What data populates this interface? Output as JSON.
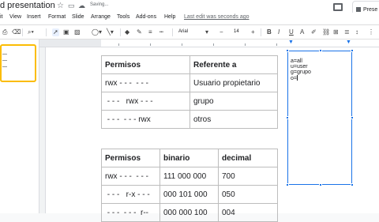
{
  "title": {
    "doc_name": "d presentation",
    "status": "Saving..."
  },
  "present_button": "Prese",
  "menu": [
    "it",
    "View",
    "Insert",
    "Format",
    "Slide",
    "Arrange",
    "Tools",
    "Add-ons",
    "Help"
  ],
  "last_edit": "Last edit was seconds ago",
  "toolbar": {
    "font": "Arial",
    "font_size": "14",
    "minus": "−",
    "plus": "+"
  },
  "table1": {
    "headers": [
      "Permisos",
      "Referente a"
    ],
    "rows": [
      [
        "rwx - - -  - - -",
        "Usuario propietario"
      ],
      [
        " - - -   rwx - - -",
        "grupo"
      ],
      [
        " - - -  - - - rwx",
        "otros"
      ]
    ]
  },
  "table2": {
    "headers": [
      "Permisos",
      "binario",
      "decimal"
    ],
    "rows": [
      [
        "rwx - - -  - - -",
        "111 000 000",
        "700"
      ],
      [
        " - - -   r-x - - -",
        "000 101 000",
        "050"
      ],
      [
        " - - -  - - -  r--",
        "000 000 100",
        "004"
      ]
    ]
  },
  "textbox": {
    "lines": [
      "a=all",
      "u=user",
      "g=grupo",
      "o="
    ]
  },
  "colors": {
    "accent": "#1a73e8",
    "selected_slide_border": "#fbbc04"
  }
}
